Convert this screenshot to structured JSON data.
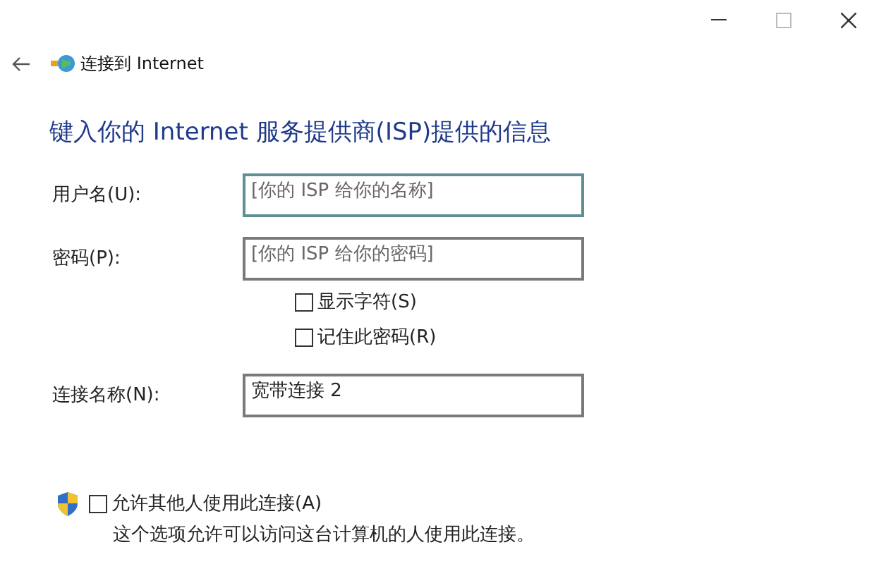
{
  "window": {
    "title": "连接到 Internet"
  },
  "heading": "键入你的 Internet 服务提供商(ISP)提供的信息",
  "fields": [
    {
      "label": "用户名(U):",
      "placeholder": "[你的 ISP 给你的名称]",
      "focused": true
    },
    {
      "label": "密码(P):",
      "placeholder": "[你的 ISP 给你的密码]",
      "focused": false
    }
  ],
  "password_options": [
    {
      "label": "显示字符(S)",
      "checked": false
    },
    {
      "label": "记住此密码(R)",
      "checked": false
    }
  ],
  "connection_name": {
    "label": "连接名称(N):",
    "value": "宽带连接 2",
    "focused": false
  },
  "allow_others": {
    "label": "允许其他人使用此连接(A)",
    "checked": false,
    "description": "这个选项允许可以访问这台计算机的人使用此连接。"
  }
}
